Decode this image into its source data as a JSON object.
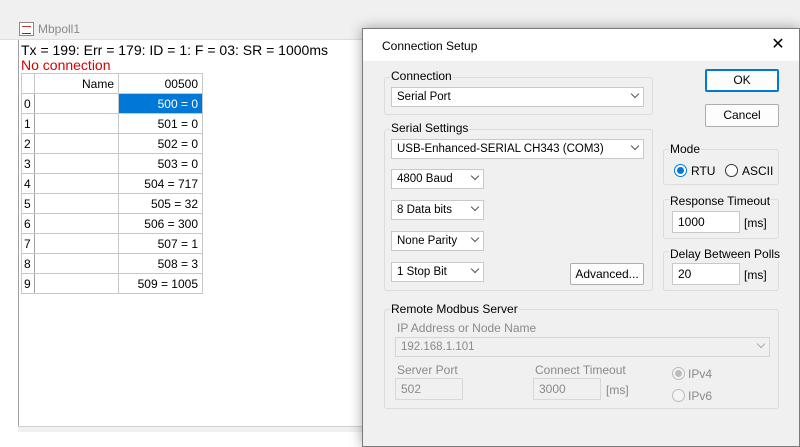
{
  "bg_window": {
    "title": "Mbpoll1",
    "status_line": "Tx = 199: Err = 179: ID = 1: F = 03: SR = 1000ms",
    "error_line": "No connection",
    "grid": {
      "header_name": "Name",
      "header_col": "00500",
      "rows": [
        {
          "idx": "0",
          "name": "",
          "value": "500 = 0"
        },
        {
          "idx": "1",
          "name": "",
          "value": "501 = 0"
        },
        {
          "idx": "2",
          "name": "",
          "value": "502 = 0"
        },
        {
          "idx": "3",
          "name": "",
          "value": "503 = 0"
        },
        {
          "idx": "4",
          "name": "",
          "value": "504 = 717"
        },
        {
          "idx": "5",
          "name": "",
          "value": "505 = 32"
        },
        {
          "idx": "6",
          "name": "",
          "value": "506 = 300"
        },
        {
          "idx": "7",
          "name": "",
          "value": "507 = 1"
        },
        {
          "idx": "8",
          "name": "",
          "value": "508 = 3"
        },
        {
          "idx": "9",
          "name": "",
          "value": "509 = 1005"
        }
      ]
    }
  },
  "dialog": {
    "title": "Connection Setup",
    "close_icon": "close-icon",
    "connection": {
      "label": "Connection",
      "value": "Serial Port"
    },
    "serial_settings": {
      "label": "Serial Settings",
      "port": "USB-Enhanced-SERIAL CH343 (COM3)",
      "baud": "4800 Baud",
      "data_bits": "8 Data bits",
      "parity": "None Parity",
      "stop_bits": "1 Stop Bit",
      "advanced_label": "Advanced..."
    },
    "buttons": {
      "ok": "OK",
      "cancel": "Cancel"
    },
    "mode": {
      "label": "Mode",
      "rtu": "RTU",
      "ascii": "ASCII",
      "selected": "RTU"
    },
    "response_timeout": {
      "label": "Response Timeout",
      "value": "1000",
      "unit": "[ms]"
    },
    "delay_between_polls": {
      "label": "Delay Between Polls",
      "value": "20",
      "unit": "[ms]"
    },
    "remote_server": {
      "label": "Remote Modbus Server",
      "ip_label": "IP Address or Node Name",
      "ip_value": "192.168.1.101",
      "port_label": "Server Port",
      "port_value": "502",
      "timeout_label": "Connect Timeout",
      "timeout_value": "3000",
      "timeout_unit": "[ms]",
      "ipv4": "IPv4",
      "ipv6": "IPv6",
      "selected": "IPv4"
    }
  },
  "colors": {
    "selection": "#0078d7",
    "error_text": "#d40000",
    "dialog_bg": "#f0f0f0"
  }
}
